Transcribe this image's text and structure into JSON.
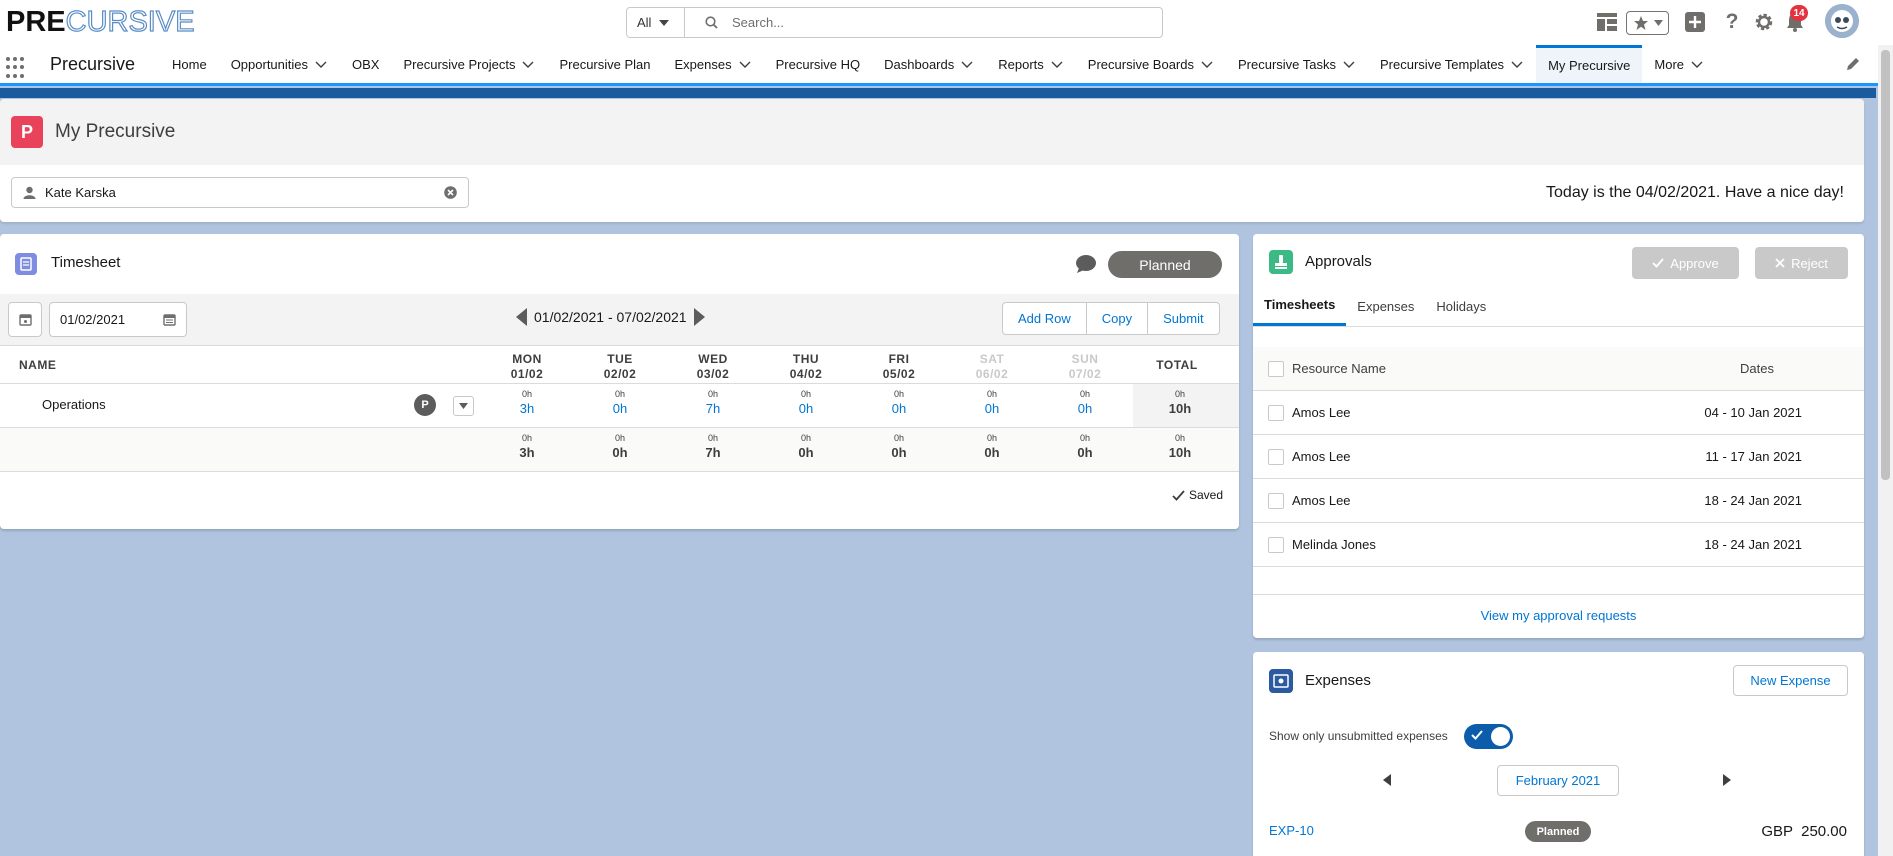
{
  "header": {
    "logo_bold": "PRE",
    "logo_outline": "CURSIVE",
    "search_scope": "All",
    "search_placeholder": "Search...",
    "notification_count": "14"
  },
  "nav": {
    "app_name": "Precursive",
    "items": [
      {
        "label": "Home",
        "dropdown": false
      },
      {
        "label": "Opportunities",
        "dropdown": true
      },
      {
        "label": "OBX",
        "dropdown": false
      },
      {
        "label": "Precursive Projects",
        "dropdown": true
      },
      {
        "label": "Precursive Plan",
        "dropdown": false
      },
      {
        "label": "Expenses",
        "dropdown": true
      },
      {
        "label": "Precursive HQ",
        "dropdown": false
      },
      {
        "label": "Dashboards",
        "dropdown": true
      },
      {
        "label": "Reports",
        "dropdown": true
      },
      {
        "label": "Precursive Boards",
        "dropdown": true
      },
      {
        "label": "Precursive Tasks",
        "dropdown": true
      },
      {
        "label": "Precursive Templates",
        "dropdown": true
      },
      {
        "label": "My Precursive",
        "dropdown": false,
        "active": true
      },
      {
        "label": "More",
        "dropdown": true
      }
    ]
  },
  "page": {
    "icon_letter": "P",
    "title": "My Precursive",
    "user": "Kate Karska",
    "today": "Today is the 04/02/2021. Have a nice day!"
  },
  "timesheet": {
    "title": "Timesheet",
    "status": "Planned",
    "date": "01/02/2021",
    "range": "01/02/2021 - 07/02/2021",
    "buttons": [
      "Add Row",
      "Copy",
      "Submit"
    ],
    "name_header": "NAME",
    "total_header": "TOTAL",
    "days": [
      {
        "dow": "MON",
        "date": "01/02",
        "weekend": false
      },
      {
        "dow": "TUE",
        "date": "02/02",
        "weekend": false
      },
      {
        "dow": "WED",
        "date": "03/02",
        "weekend": false
      },
      {
        "dow": "THU",
        "date": "04/02",
        "weekend": false
      },
      {
        "dow": "FRI",
        "date": "05/02",
        "weekend": false
      },
      {
        "dow": "SAT",
        "date": "06/02",
        "weekend": true
      },
      {
        "dow": "SUN",
        "date": "07/02",
        "weekend": true
      }
    ],
    "row": {
      "name": "Operations",
      "badge": "P",
      "small": [
        "0h",
        "0h",
        "0h",
        "0h",
        "0h",
        "0h",
        "0h"
      ],
      "hours": [
        "3h",
        "0h",
        "7h",
        "0h",
        "0h",
        "0h",
        "0h"
      ],
      "total_small": "0h",
      "total": "10h"
    },
    "totals": {
      "small": [
        "0h",
        "0h",
        "0h",
        "0h",
        "0h",
        "0h",
        "0h"
      ],
      "hours": [
        "3h",
        "0h",
        "7h",
        "0h",
        "0h",
        "0h",
        "0h"
      ],
      "total_small": "0h",
      "total": "10h"
    },
    "saved": "Saved"
  },
  "approvals": {
    "title": "Approvals",
    "approve": "Approve",
    "reject": "Reject",
    "tabs": [
      "Timesheets",
      "Expenses",
      "Holidays"
    ],
    "col_name": "Resource Name",
    "col_dates": "Dates",
    "rows": [
      {
        "name": "Amos Lee",
        "dates": "04 - 10 Jan 2021"
      },
      {
        "name": "Amos Lee",
        "dates": "11 - 17 Jan 2021"
      },
      {
        "name": "Amos Lee",
        "dates": "18 - 24 Jan 2021"
      },
      {
        "name": "Melinda Jones",
        "dates": "18 - 24 Jan 2021"
      }
    ],
    "view_link": "View my approval requests"
  },
  "expenses": {
    "title": "Expenses",
    "new_button": "New Expense",
    "toggle_label": "Show only unsubmitted expenses",
    "toggle_on": true,
    "month": "February 2021",
    "item": {
      "id": "EXP-10",
      "status": "Planned",
      "amount": "GBP  250.00"
    }
  },
  "colors": {
    "brand": "#0176d3",
    "background": "#b0c4df",
    "banner": "#1a5a9e",
    "page_icon": "#e8435a",
    "approvals_icon": "#3bba85",
    "timesheet_icon": "#7f8de1"
  }
}
